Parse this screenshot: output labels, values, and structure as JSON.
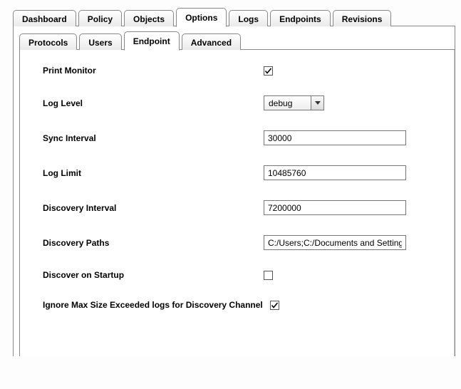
{
  "main_tabs": {
    "items": [
      {
        "label": "Dashboard"
      },
      {
        "label": "Policy"
      },
      {
        "label": "Objects"
      },
      {
        "label": "Options"
      },
      {
        "label": "Logs"
      },
      {
        "label": "Endpoints"
      },
      {
        "label": "Revisions"
      }
    ],
    "active_index": 3
  },
  "sub_tabs": {
    "items": [
      {
        "label": "Protocols"
      },
      {
        "label": "Users"
      },
      {
        "label": "Endpoint"
      },
      {
        "label": "Advanced"
      }
    ],
    "active_index": 2
  },
  "form": {
    "print_monitor": {
      "label": "Print Monitor",
      "checked": true
    },
    "log_level": {
      "label": "Log Level",
      "value": "debug"
    },
    "sync_interval": {
      "label": "Sync Interval",
      "value": "30000"
    },
    "log_limit": {
      "label": "Log Limit",
      "value": "10485760"
    },
    "discovery_interval": {
      "label": "Discovery Interval",
      "value": "7200000"
    },
    "discovery_paths": {
      "label": "Discovery Paths",
      "value": "C:/Users;C:/Documents and Settings"
    },
    "discover_on_startup": {
      "label": "Discover on Startup",
      "checked": false
    },
    "ignore_max_size": {
      "label": "Ignore Max Size Exceeded logs for Discovery Channel",
      "checked": true
    }
  }
}
